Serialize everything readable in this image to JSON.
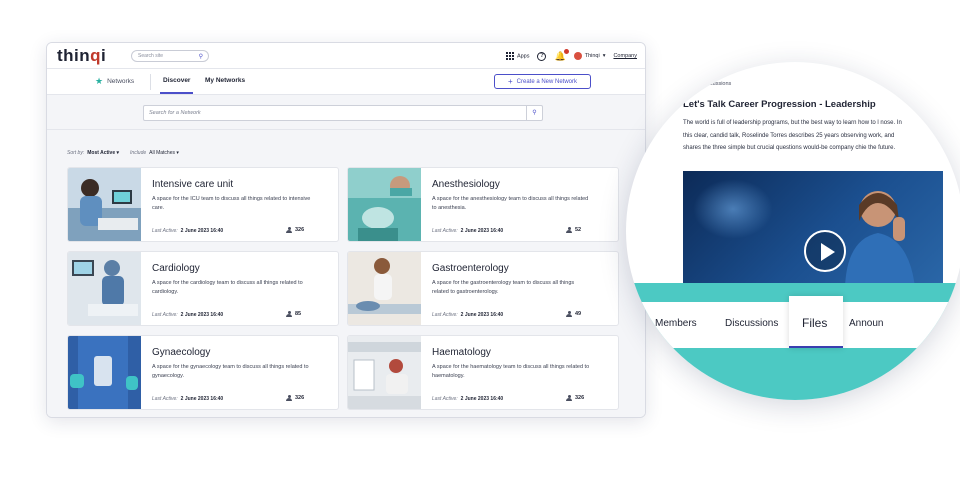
{
  "app": {
    "logo": {
      "prefix": "thin",
      "accent": "q",
      "suffix": "i"
    },
    "site_search_placeholder": "Search site",
    "topright": {
      "apps_label": "Apps",
      "help": "?",
      "user_name": "Thinqi",
      "company_label": "Company"
    }
  },
  "subnav": {
    "networks_label": "Networks",
    "tabs": [
      {
        "label": "Discover",
        "active": true
      },
      {
        "label": "My Networks",
        "active": false
      }
    ],
    "create_button": "Create a New Network"
  },
  "search": {
    "placeholder": "Search for a Network"
  },
  "sort": {
    "sort_label": "Sort by:",
    "sort_value": "Most Active",
    "include_label": "Include",
    "include_value": "All Matches"
  },
  "networks": [
    {
      "title": "Intensive care unit",
      "description": "A space for the ICU team to discuss all things related to intensive care.",
      "last_active_label": "Last Active:",
      "last_active": "2 June 2023 16:40",
      "members": "326"
    },
    {
      "title": "Anesthesiology",
      "description": "A space for the anesthesiology team to discuss all things related to anesthesia.",
      "last_active_label": "Last Active:",
      "last_active": "2 June 2023 16:40",
      "members": "52"
    },
    {
      "title": "Cardiology",
      "description": "A space for the cardiology team to discuss all things related to cardiology.",
      "last_active_label": "Last Active:",
      "last_active": "2 June 2023 16:40",
      "members": "85"
    },
    {
      "title": "Gastroenterology",
      "description": "A space for the gastroenterology team to discuss all things related to gastroenterology.",
      "last_active_label": "Last Active:",
      "last_active": "2 June 2023 16:40",
      "members": "49"
    },
    {
      "title": "Gynaecology",
      "description": "A space for the gynaecology team to discuss all things related to gynaecology.",
      "last_active_label": "Last Active:",
      "last_active": "2 June 2023 16:40",
      "members": "326"
    },
    {
      "title": "Haematology",
      "description": "A space for the haematology team to discuss all things related to haematology.",
      "last_active_label": "Last Active:",
      "last_active": "2 June 2023 16:40",
      "members": "326"
    }
  ],
  "detail": {
    "back_link": "Back to discussions",
    "title": "Let's Talk Career Progression - Leadership",
    "body": "The world is full of leadership programs, but the best way to learn how to l nose. In this clear, candid talk, Roselinde Torres describes 25 years observing work, and shares the three simple but crucial questions would-be company chie the future.",
    "tabs": [
      "Members",
      "Discussions",
      "Files",
      "Announ"
    ],
    "active_tab": "Files"
  },
  "colors": {
    "accent": "#4b4fc9",
    "teal": "#4cc9c3",
    "star": "#27b0a0",
    "notification": "#d0392b"
  },
  "icons": {
    "search": "search-icon",
    "apps": "apps-grid-icon",
    "help": "help-icon",
    "bell": "bell-icon",
    "members": "person-icon",
    "play": "play-icon",
    "star": "star-icon"
  }
}
